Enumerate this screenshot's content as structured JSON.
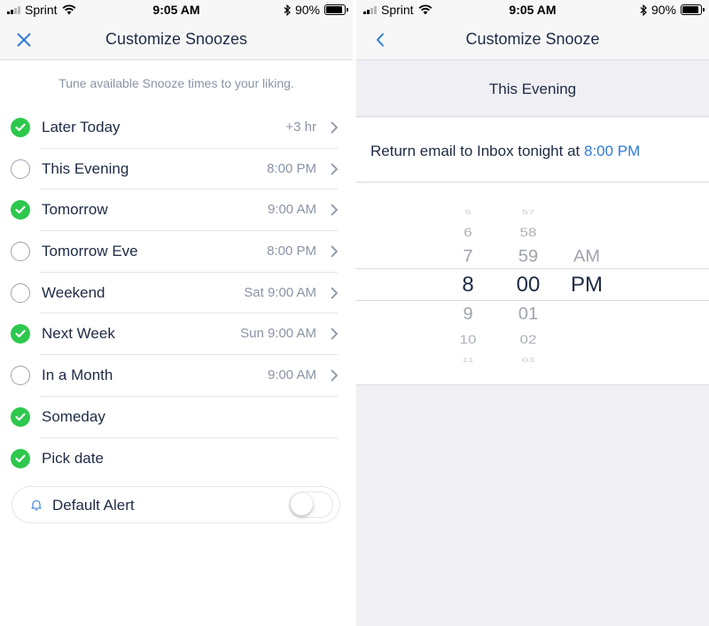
{
  "status_bar": {
    "carrier": "Sprint",
    "time": "9:05 AM",
    "battery": "90%",
    "battery_level": 0.9
  },
  "left": {
    "title": "Customize Snoozes",
    "subtitle": "Tune available Snooze times to your liking.",
    "items": [
      {
        "label": "Later Today",
        "value": "+3 hr",
        "checked": true,
        "chevron": true
      },
      {
        "label": "This Evening",
        "value": "8:00 PM",
        "checked": false,
        "chevron": true
      },
      {
        "label": "Tomorrow",
        "value": "9:00 AM",
        "checked": true,
        "chevron": true
      },
      {
        "label": "Tomorrow Eve",
        "value": "8:00 PM",
        "checked": false,
        "chevron": true
      },
      {
        "label": "Weekend",
        "value": "Sat 9:00 AM",
        "checked": false,
        "chevron": true
      },
      {
        "label": "Next Week",
        "value": "Sun 9:00 AM",
        "checked": true,
        "chevron": true
      },
      {
        "label": "In a Month",
        "value": "9:00 AM",
        "checked": false,
        "chevron": true
      },
      {
        "label": "Someday",
        "value": "",
        "checked": true,
        "chevron": false
      },
      {
        "label": "Pick date",
        "value": "",
        "checked": true,
        "chevron": false
      }
    ],
    "default_alert": {
      "label": "Default Alert",
      "on": false
    }
  },
  "right": {
    "title": "Customize Snooze",
    "section_title": "This Evening",
    "return_text": "Return email to Inbox tonight at",
    "return_time": "8:00 PM",
    "picker": {
      "hours": [
        "5",
        "6",
        "7",
        "8",
        "9",
        "10",
        "11"
      ],
      "minutes": [
        "57",
        "58",
        "59",
        "00",
        "01",
        "02",
        "03"
      ],
      "meridiem": [
        "AM",
        "PM"
      ],
      "selected_hour": "8",
      "selected_minute": "00",
      "selected_meridiem": "PM"
    }
  },
  "colors": {
    "accent": "#2f7bd9",
    "check_green": "#2dc84d",
    "text_dark": "#1e2a44",
    "text_muted": "#8a94a6"
  },
  "icons": [
    "signal-icon",
    "wifi-icon",
    "bluetooth-icon",
    "battery-icon",
    "close-icon",
    "back-chevron-icon",
    "checkmark-icon",
    "chevron-right-icon",
    "bell-icon"
  ]
}
